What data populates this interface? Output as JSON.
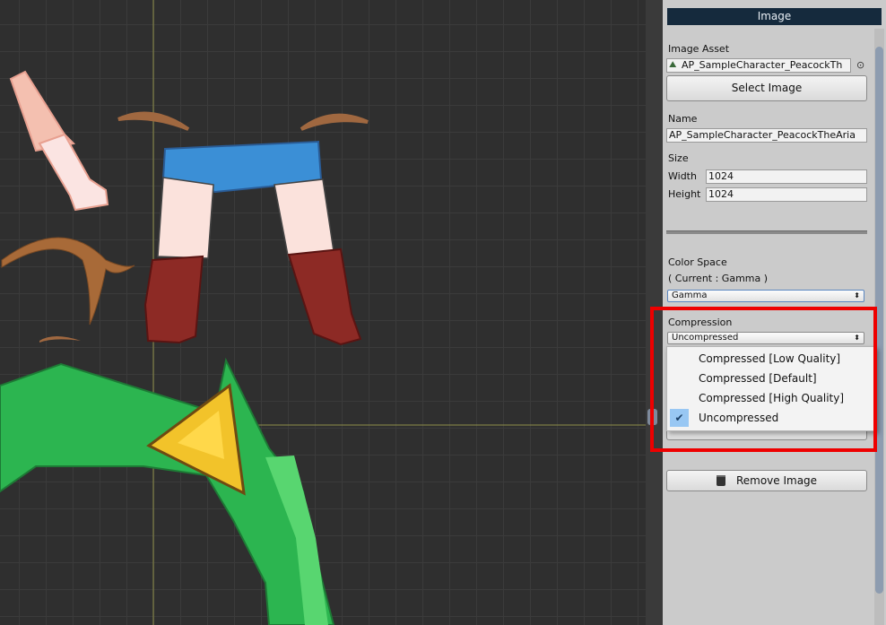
{
  "panel": {
    "title": "Image",
    "image_asset_label": "Image Asset",
    "image_asset_value": "AP_SampleCharacter_PeacockTh",
    "select_image_button": "Select Image",
    "name_label": "Name",
    "name_value": "AP_SampleCharacter_PeacockTheAria",
    "size_label": "Size",
    "width_label": "Width",
    "width_value": "1024",
    "height_label": "Height",
    "height_value": "1024",
    "color_space_label": "Color Space",
    "color_space_current": "( Current : Gamma )",
    "color_space_select": "Gamma",
    "compression_label": "Compression",
    "compression_select": "Uncompressed",
    "remove_image_button": "Remove Image"
  },
  "dropdown": {
    "options": [
      {
        "label": "Compressed [Low Quality]",
        "selected": false
      },
      {
        "label": "Compressed [Default]",
        "selected": false
      },
      {
        "label": "Compressed [High Quality]",
        "selected": false
      },
      {
        "label": "Uncompressed",
        "selected": true
      }
    ],
    "check_glyph": "✔"
  },
  "colors": {
    "highlight": "#ee0000",
    "panel_header": "#152a3d",
    "selected_item": "#98c7f3"
  }
}
